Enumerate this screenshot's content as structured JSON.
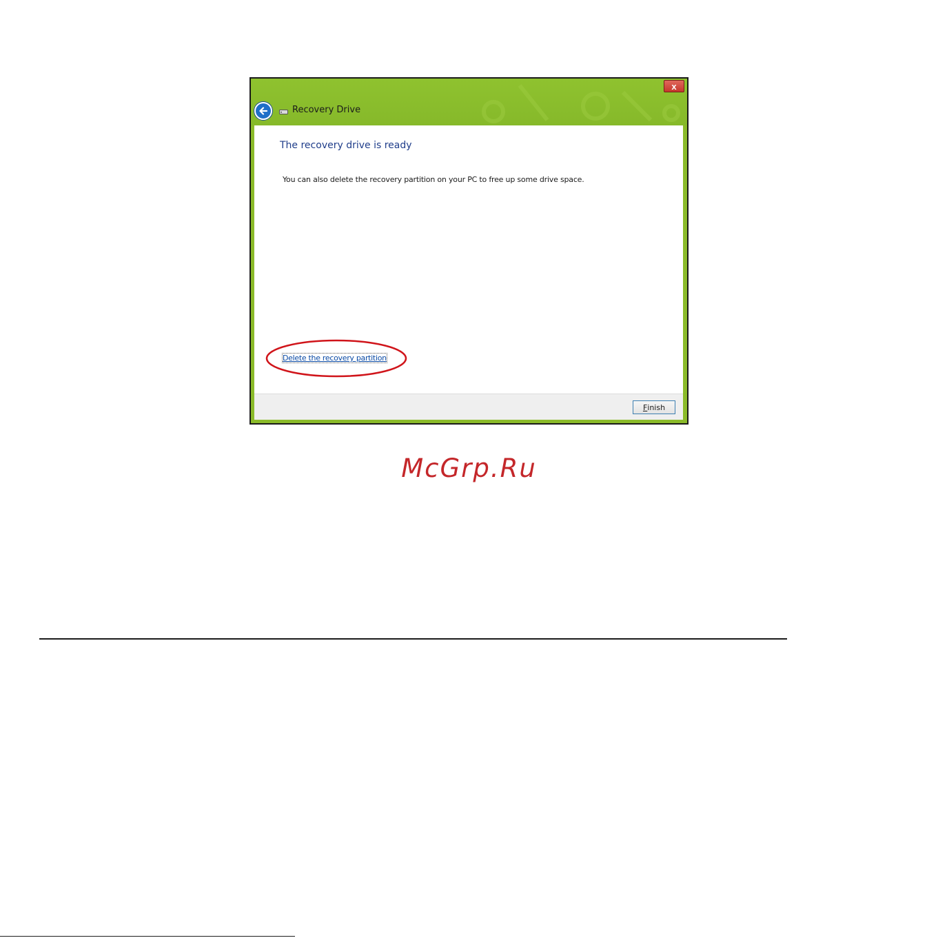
{
  "window": {
    "title": "Recovery Drive",
    "close_label": "x",
    "accent_color": "#8bbb2a"
  },
  "content": {
    "heading": "The recovery drive is ready",
    "description": "You can also delete the recovery partition on your PC to free up some drive space.",
    "link": "Delete the recovery partition",
    "highlight_color": "#d0141a"
  },
  "footer": {
    "finish_first": "F",
    "finish_rest": "inish"
  },
  "watermark": "McGrp.Ru"
}
